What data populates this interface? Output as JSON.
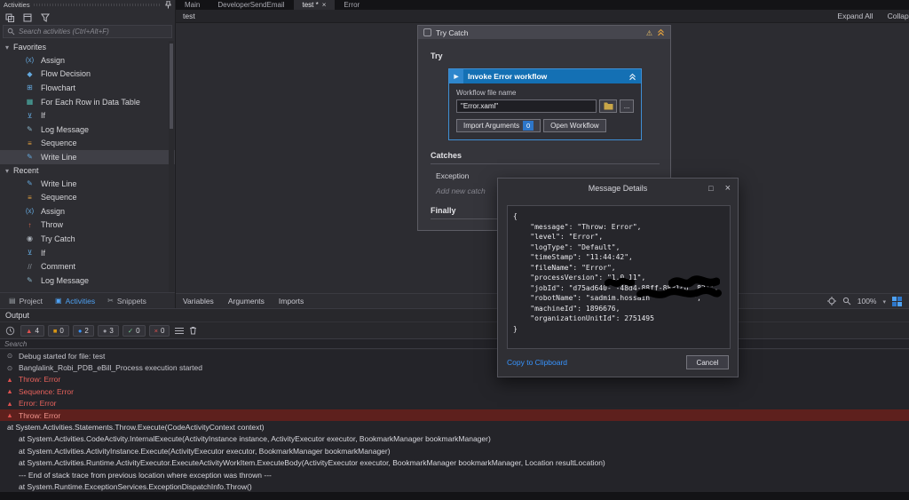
{
  "activities_panel": {
    "title": "Activities",
    "search_placeholder": "Search activities (Ctrl+Alt+F)",
    "favorites": {
      "label": "Favorites",
      "items": [
        {
          "label": "Assign",
          "icon": "assign-icon"
        },
        {
          "label": "Flow Decision",
          "icon": "flow-decision-icon"
        },
        {
          "label": "Flowchart",
          "icon": "flowchart-icon"
        },
        {
          "label": "For Each Row in Data Table",
          "icon": "for-each-row-icon"
        },
        {
          "label": "If",
          "icon": "if-icon"
        },
        {
          "label": "Log Message",
          "icon": "log-message-icon"
        },
        {
          "label": "Sequence",
          "icon": "sequence-icon"
        },
        {
          "label": "Write Line",
          "icon": "write-line-icon",
          "selected": true
        }
      ]
    },
    "recent": {
      "label": "Recent",
      "items": [
        {
          "label": "Write Line",
          "icon": "write-line-icon"
        },
        {
          "label": "Sequence",
          "icon": "sequence-icon"
        },
        {
          "label": "Assign",
          "icon": "assign-icon"
        },
        {
          "label": "Throw",
          "icon": "throw-icon"
        },
        {
          "label": "Try Catch",
          "icon": "try-catch-icon"
        },
        {
          "label": "If",
          "icon": "if-icon"
        },
        {
          "label": "Comment",
          "icon": "comment-icon"
        },
        {
          "label": "Log Message",
          "icon": "log-message-icon"
        }
      ]
    },
    "bottom_tabs": [
      {
        "label": "Project",
        "icon": "folder-icon"
      },
      {
        "label": "Activities",
        "icon": "activities-icon",
        "active": true
      },
      {
        "label": "Snippets",
        "icon": "snippets-icon"
      }
    ]
  },
  "document_tabs": [
    {
      "label": "Main"
    },
    {
      "label": "DeveloperSendEmail"
    },
    {
      "label": "test *",
      "active": true,
      "closable": true
    },
    {
      "label": "Error"
    }
  ],
  "designer": {
    "breadcrumb": "test",
    "expand_all_label": "Expand All",
    "collapse_all_label": "Collapse All",
    "try_catch": {
      "title": "Try Catch",
      "sections": {
        "try": "Try",
        "catches": "Catches",
        "finally": "Finally"
      },
      "exception_label": "Exception",
      "add_new_catch_placeholder": "Add new catch",
      "invoke": {
        "title": "Invoke Error workflow",
        "field_label": "Workflow file name",
        "field_value": "\"Error.xaml\"",
        "browse_ellipsis": "...",
        "import_arguments_label": "Import Arguments",
        "import_arguments_count": "0",
        "open_workflow_label": "Open Workflow"
      }
    },
    "panel_tabs": [
      "Variables",
      "Arguments",
      "Imports"
    ],
    "zoom_level": "100%"
  },
  "dialog": {
    "title": "Message Details",
    "body_json": "{\n    \"message\": \"Throw: Error\",\n    \"level\": \"Error\",\n    \"logType\": \"Default\",\n    \"timeStamp\": \"11:44:42\",\n    \"fileName\": \"Error\",\n    \"processVersion\": \"1.0.11\",\n    \"jobId\": \"d75ad640- -48d4-88ff-8881cb  821\",\n    \"robotName\": \"sadmim.hossain          \",\n    \"machineId\": 1896676,\n    \"organizationUnitId\": 2751495\n}",
    "copy_link_label": "Copy to Clipboard",
    "cancel_label": "Cancel"
  },
  "output_panel": {
    "title": "Output",
    "search_placeholder": "Search",
    "filters": [
      {
        "icon": "errors-icon",
        "count": "4"
      },
      {
        "icon": "warnings-icon",
        "count": "0"
      },
      {
        "icon": "info-icon",
        "count": "2"
      },
      {
        "icon": "trace-icon",
        "count": "3"
      },
      {
        "icon": "success-icon",
        "count": "0"
      },
      {
        "icon": "fail-icon",
        "count": "0"
      }
    ],
    "logs": [
      {
        "icon": "clock-icon",
        "type": "info",
        "text": "Debug started for file: test"
      },
      {
        "icon": "clock-icon",
        "type": "info",
        "text": "Banglalink_Robi_PDB_eBill_Process execution started"
      },
      {
        "icon": "error-icon",
        "type": "error",
        "text": "Throw: Error"
      },
      {
        "icon": "error-icon",
        "type": "error",
        "text": "Sequence: Error"
      },
      {
        "icon": "error-icon",
        "type": "error",
        "text": "Error: Error"
      },
      {
        "icon": "error-icon",
        "type": "error",
        "selected": true,
        "text": "Throw: Error"
      },
      {
        "type": "stack",
        "indent": "shallow",
        "text": "at System.Activities.Statements.Throw.Execute(CodeActivityContext context)"
      },
      {
        "type": "stack",
        "indent": "deep",
        "text": "at System.Activities.CodeActivity.InternalExecute(ActivityInstance instance, ActivityExecutor executor, BookmarkManager bookmarkManager)"
      },
      {
        "type": "stack",
        "indent": "deep",
        "text": "at System.Activities.ActivityInstance.Execute(ActivityExecutor executor, BookmarkManager bookmarkManager)"
      },
      {
        "type": "stack",
        "indent": "deep",
        "text": "at System.Activities.Runtime.ActivityExecutor.ExecuteActivityWorkItem.ExecuteBody(ActivityExecutor executor, BookmarkManager bookmarkManager, Location resultLocation)"
      },
      {
        "type": "stack",
        "indent": "deep",
        "text": "--- End of stack trace from previous location where exception was thrown ---"
      },
      {
        "type": "stack",
        "indent": "deep",
        "text": "at System.Runtime.ExceptionServices.ExceptionDispatchInfo.Throw()"
      }
    ]
  }
}
